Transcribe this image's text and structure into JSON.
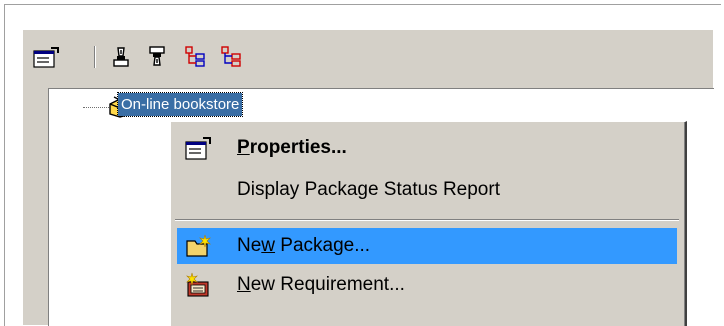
{
  "toolbar": {
    "buttons": [
      {
        "name": "properties-icon"
      },
      {
        "name": "add-pen-icon"
      },
      {
        "name": "remove-pen-icon"
      },
      {
        "name": "expand-tree-icon"
      },
      {
        "name": "collapse-tree-icon"
      }
    ]
  },
  "tree": {
    "root": {
      "label": "On-line bookstore",
      "icon": "package-icon"
    }
  },
  "context_menu": {
    "items": [
      {
        "pre": "",
        "key": "P",
        "post": "roperties...",
        "icon": "properties-icon",
        "bold": true,
        "highlighted": false
      },
      {
        "pre": "Display Package Status Report",
        "key": "",
        "post": "",
        "icon": "",
        "bold": false,
        "highlighted": false
      },
      {
        "pre": "Ne",
        "key": "w",
        "post": " Package...",
        "icon": "new-package-icon",
        "bold": false,
        "highlighted": true
      },
      {
        "pre": "",
        "key": "N",
        "post": "ew Requirement...",
        "icon": "new-requirement-icon",
        "bold": false,
        "highlighted": false
      }
    ]
  },
  "colors": {
    "face": "#d4d0c8",
    "selection": "#3399ff",
    "tree_selection": "#3a6ea5"
  }
}
